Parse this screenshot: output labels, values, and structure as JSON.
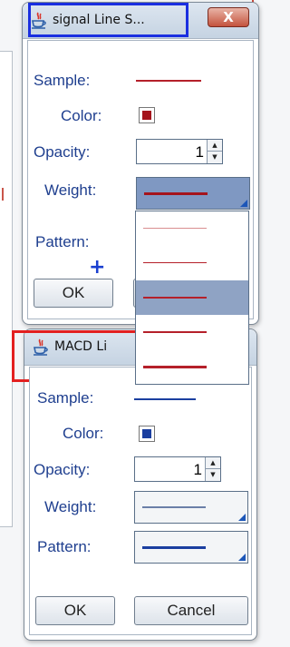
{
  "colors": {
    "signal_line": "#b5202a",
    "macd_line": "#1b3fa0",
    "highlight_blue": "#1a2fe0",
    "highlight_red": "#e32020",
    "selection": "#8fa3c4"
  },
  "signal_dialog": {
    "title": "signal Line S...",
    "app_icon": "java-cup-icon",
    "close_icon": "close-x-icon",
    "close_label": "X",
    "labels": {
      "sample": "Sample:",
      "color": "Color:",
      "opacity": "Opacity:",
      "weight": "Weight:",
      "pattern": "Pattern:"
    },
    "opacity_value": "1",
    "ok_label": "OK",
    "weight_options": [
      "thin",
      "thin",
      "medium",
      "medium",
      "thick",
      "thick"
    ],
    "selected_weight_index": 2
  },
  "macd_dialog": {
    "title": "MACD Li",
    "app_icon": "java-cup-icon",
    "labels": {
      "sample": "Sample:",
      "color": "Color:",
      "opacity": "Opacity:",
      "weight": "Weight:",
      "pattern": "Pattern:"
    },
    "opacity_value": "1",
    "ok_label": "OK",
    "cancel_label": "Cancel"
  }
}
